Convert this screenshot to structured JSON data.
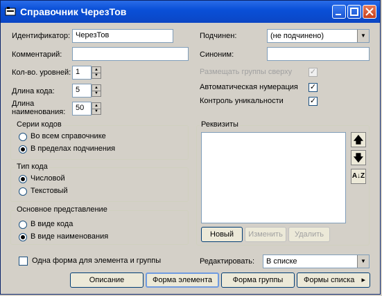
{
  "window": {
    "title": "Справочник ЧерезТов"
  },
  "fields": {
    "identifier_label": "Идентификатор:",
    "identifier_value": "ЧерезТов",
    "comment_label": "Комментарий:",
    "comment_value": "",
    "levels_label": "Кол-во. уровней:",
    "levels_value": "1",
    "code_len_label": "Длина кода:",
    "code_len_value": "5",
    "name_len_label_1": "Длина",
    "name_len_label_2": "наименования:",
    "name_len_value": "50",
    "subordinate_label": "Подчинен:",
    "subordinate_value": "(не подчинено)",
    "synonym_label": "Синоним:",
    "synonym_value": ""
  },
  "checks": {
    "groups_top": "Размещать группы сверху",
    "auto_number": "Автоматическая нумерация",
    "unique_control": "Контроль уникальности",
    "one_form": "Одна форма для элемента и группы"
  },
  "code_series": {
    "title": "Серии кодов",
    "option1": "Во всем справочнике",
    "option2": "В пределах подчинения"
  },
  "code_type": {
    "title": "Тип кода",
    "option1": "Числовой",
    "option2": "Текстовый"
  },
  "main_view": {
    "title": "Основное представление",
    "option1": "В виде кода",
    "option2": "В виде наименования"
  },
  "requisites": {
    "title": "Реквизиты",
    "new": "Новый",
    "edit": "Изменить",
    "delete": "Удалить"
  },
  "edit_mode": {
    "label": "Редактировать:",
    "value": "В списке"
  },
  "bottom_buttons": {
    "description": "Описание",
    "element_form": "Форма элемента",
    "group_form": "Форма группы",
    "list_forms": "Формы списка"
  }
}
